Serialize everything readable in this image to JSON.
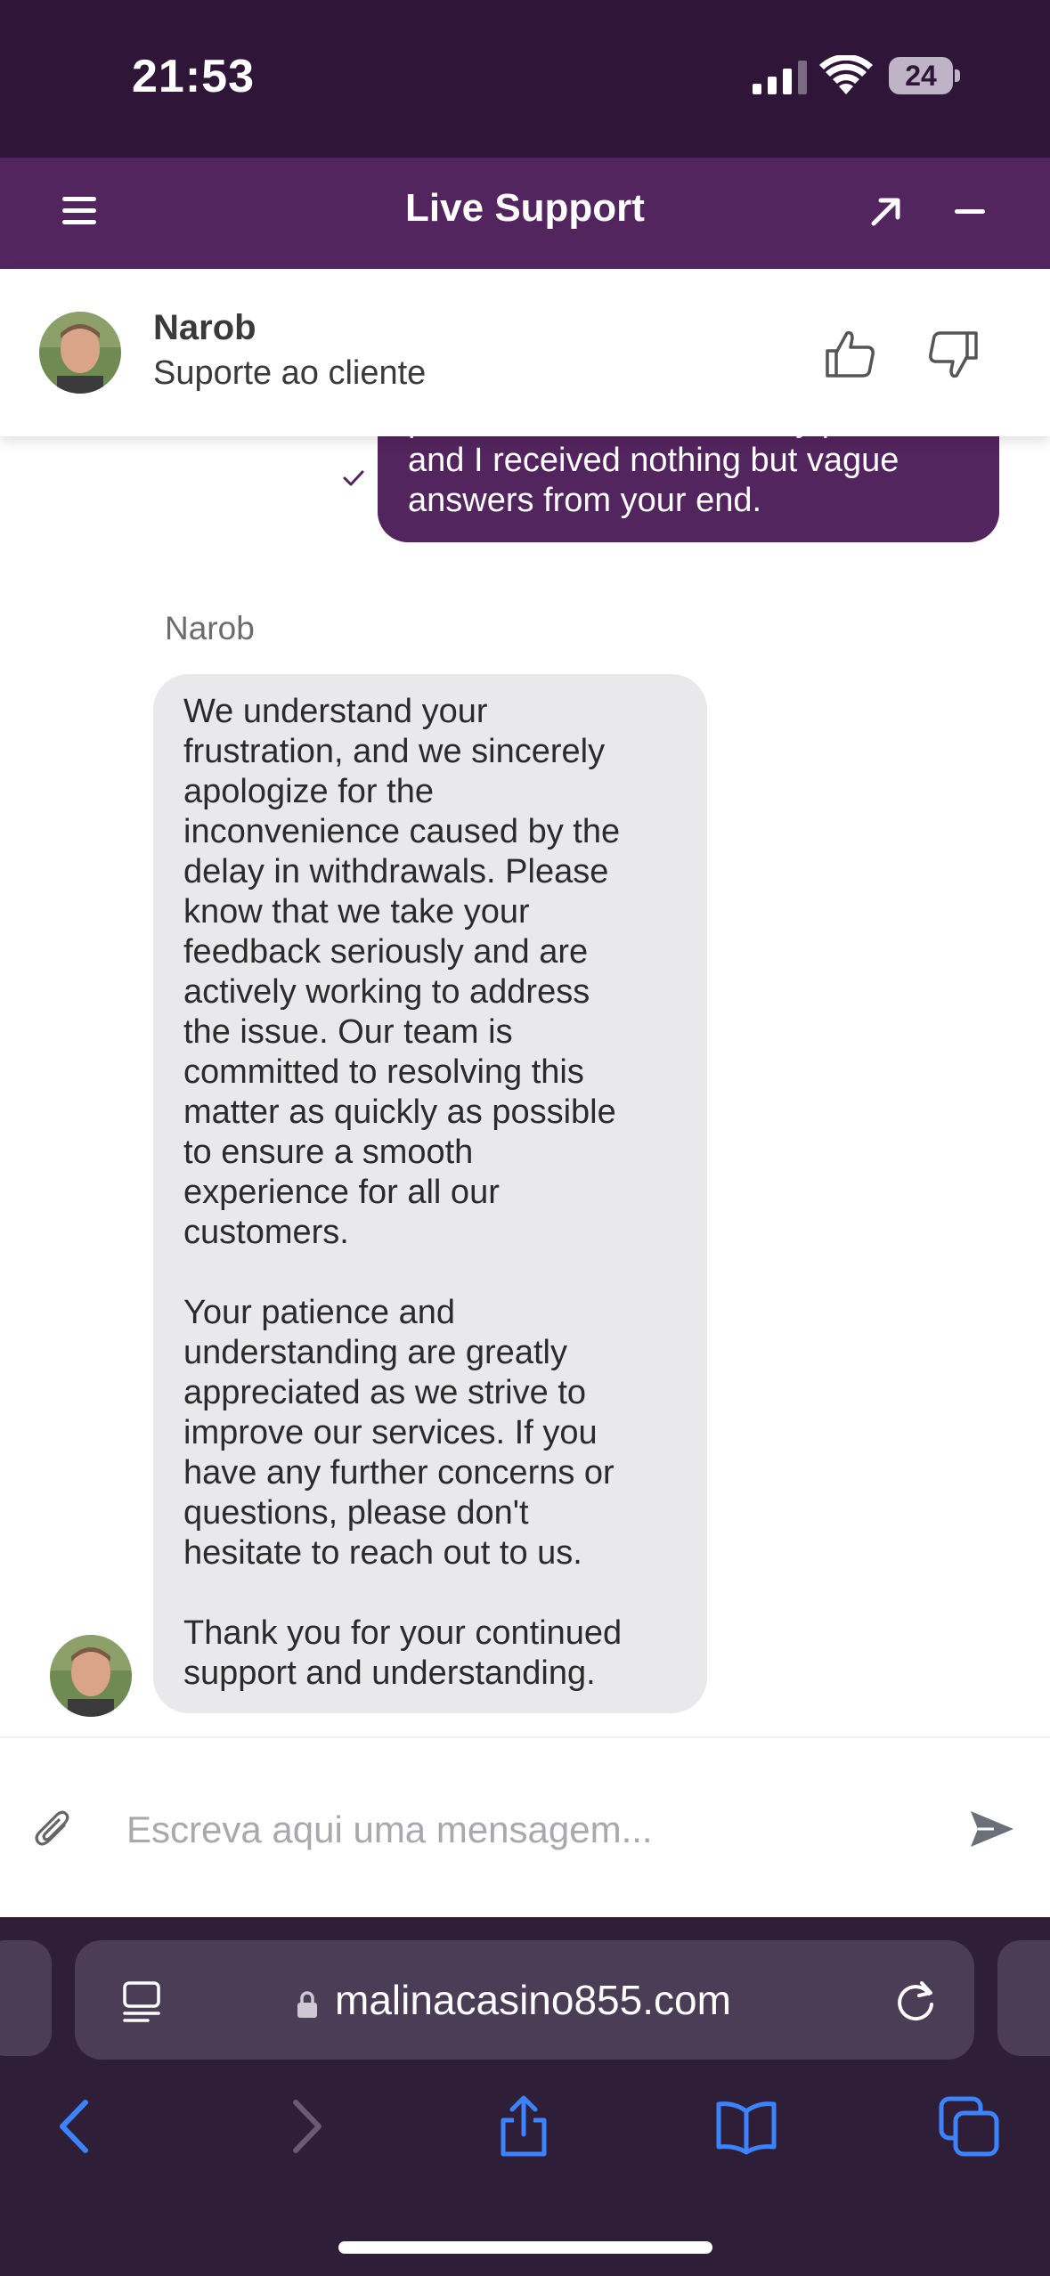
{
  "status_bar": {
    "time": "21:53",
    "battery": "24",
    "icons": [
      "cellular-signal-icon",
      "wifi-icon",
      "battery-icon"
    ]
  },
  "chat_header": {
    "title": "Live Support",
    "icons": [
      "menu-icon",
      "expand-icon",
      "minimize-icon"
    ],
    "color": "#53255f"
  },
  "agent": {
    "name": "Narob",
    "role": "Suporte ao cliente",
    "icons": [
      "thumbs-up-icon",
      "thumbs-down-icon"
    ]
  },
  "messages": {
    "user_message": "professional and extremely patient, and I received nothing but vague answers from your end.",
    "sender_name": "Narob",
    "agent_paragraphs": [
      "We understand your\nfrustration, and we sincerely\napologize for the\ninconvenience caused by the\ndelay in withdrawals. Please\nknow that we take your\nfeedback seriously and are\nactively working to address\nthe issue. Our team is\ncommitted to resolving this\nmatter as quickly as possible\nto ensure a smooth\nexperience for all our\ncustomers.",
      "Your patience and\nunderstanding are greatly\nappreciated as we strive to\nimprove our services. If you\nhave any further concerns or\nquestions, please don't\nhesitate to reach out to us.",
      "Thank you for your continued\nsupport and understanding."
    ]
  },
  "composer": {
    "placeholder": "Escreva aqui uma mensagem...",
    "icons": [
      "paperclip-icon",
      "send-icon"
    ]
  },
  "browser": {
    "url": "malinacasino855.com",
    "toolbar_icons": [
      "back-icon",
      "forward-icon",
      "share-icon",
      "bookmarks-icon",
      "tabs-icon"
    ]
  }
}
